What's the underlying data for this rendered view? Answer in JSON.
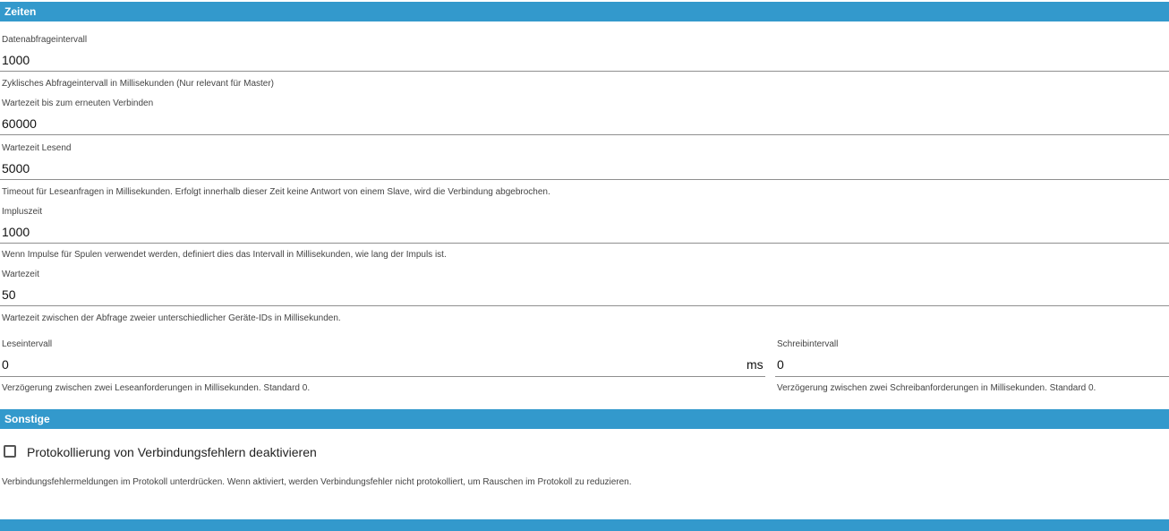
{
  "sections": {
    "zeiten": {
      "title": "Zeiten"
    },
    "sonstige": {
      "title": "Sonstige"
    }
  },
  "fields": {
    "datenabfrageintervall": {
      "label": "Datenabfrageintervall",
      "value": "1000",
      "hint": "Zyklisches Abfrageintervall in Millisekunden (Nur relevant für Master)"
    },
    "wartezeit_verbinden": {
      "label": "Wartezeit bis zum erneuten Verbinden",
      "value": "60000"
    },
    "wartezeit_lesend": {
      "label": "Wartezeit Lesend",
      "value": "5000",
      "hint": "Timeout für Leseanfragen in Millisekunden. Erfolgt innerhalb dieser Zeit keine Antwort von einem Slave, wird die Verbindung abgebrochen."
    },
    "impulszeit": {
      "label": "Impluszeit",
      "value": "1000",
      "hint": "Wenn Impulse für Spulen verwendet werden, definiert dies das Intervall in Millisekunden, wie lang der Impuls ist."
    },
    "wartezeit": {
      "label": "Wartezeit",
      "value": "50",
      "hint": "Wartezeit zwischen der Abfrage zweier unterschiedlicher Geräte-IDs in Millisekunden."
    },
    "leseintervall": {
      "label": "Leseintervall",
      "value": "0",
      "unit": "ms",
      "hint": "Verzögerung zwischen zwei Leseanforderungen in Millisekunden. Standard 0."
    },
    "schreibintervall": {
      "label": "Schreibintervall",
      "value": "0",
      "hint": "Verzögerung zwischen zwei Schreibanforderungen in Millisekunden. Standard 0."
    }
  },
  "sonstige": {
    "checkbox_label": "Protokollierung von Verbindungsfehlern deaktivieren",
    "checkbox_checked": false,
    "hint": "Verbindungsfehlermeldungen im Protokoll unterdrücken. Wenn aktiviert, werden Verbindungsfehler nicht protokolliert, um Rauschen im Protokoll zu reduzieren."
  },
  "colors": {
    "header_bg": "#3399cc",
    "header_text": "#ffffff",
    "underline": "#8f8f8f"
  }
}
